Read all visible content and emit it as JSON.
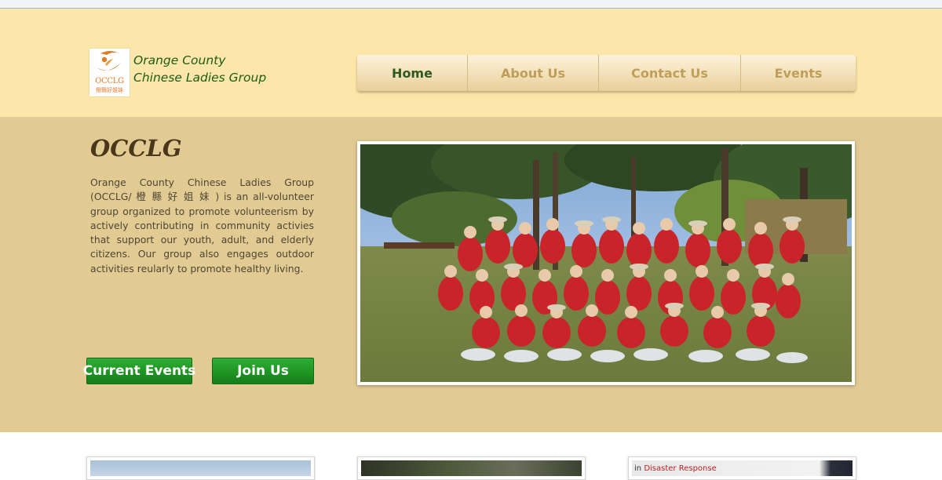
{
  "header": {
    "logo": {
      "abbr": "OCCLG",
      "chinese": "橙縣好姐妹",
      "alt_icon": "occlg-logo"
    },
    "title_line1": "Orange County",
    "title_line2": "Chinese Ladies Group"
  },
  "nav": {
    "items": [
      {
        "label": "Home",
        "active": true
      },
      {
        "label": "About Us",
        "active": false
      },
      {
        "label": "Contact Us",
        "active": false
      },
      {
        "label": "Events",
        "active": false
      }
    ]
  },
  "hero": {
    "heading": "OCCLG",
    "intro": "Orange County Chinese Ladies Group (OCCLG/ 橙 縣 好 姐 妹 )  is an all-volunteer group organized to promote volunteerism by actively contributing in community activies that support our youth, adult, and elderly citizens.  Our group also engages outdoor activities reularly to promote healthy living.",
    "buttons": {
      "current_events": "Current Events",
      "join_us": "Join Us"
    },
    "photo": {
      "icon": "group-photo-image"
    }
  },
  "thumbnails": {
    "third_caption_lead": "in",
    "third_caption": "Disaster Response"
  },
  "colors": {
    "header_bg": "#fde6a9",
    "hero_bg": "#e2cb93",
    "nav_active": "#2e5a1f",
    "nav_inactive": "#bf9e5a",
    "button_green": "#1f9424",
    "title_green": "#1d5b16"
  }
}
